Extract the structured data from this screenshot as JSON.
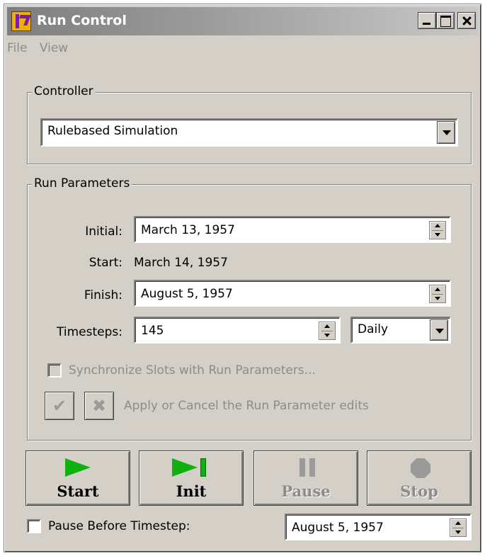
{
  "window": {
    "title": "Run Control"
  },
  "menu": {
    "items": [
      "File",
      "View"
    ]
  },
  "controller": {
    "group_label": "Controller",
    "selected": "Rulebased Simulation"
  },
  "run_parameters": {
    "group_label": "Run Parameters",
    "initial_label": "Initial:",
    "initial_value": "March 13, 1957",
    "start_label": "Start:",
    "start_value": "March 14, 1957",
    "finish_label": "Finish:",
    "finish_value": "August 5, 1957",
    "timesteps_label": "Timesteps:",
    "timesteps_value": "145",
    "timestep_unit": "Daily",
    "sync_label": "Synchronize Slots with Run Parameters...",
    "sync_checked": false,
    "apply_cancel_text": "Apply or Cancel the Run Parameter edits"
  },
  "run_buttons": {
    "start": "Start",
    "init": "Init",
    "pause": "Pause",
    "stop": "Stop"
  },
  "pause_before": {
    "label": "Pause Before Timestep:",
    "checked": false,
    "value": "August 5, 1957"
  },
  "colors": {
    "window_bg": "#d4d0c8",
    "play_green": "#10b010",
    "disabled_text": "#8c8c8c"
  }
}
